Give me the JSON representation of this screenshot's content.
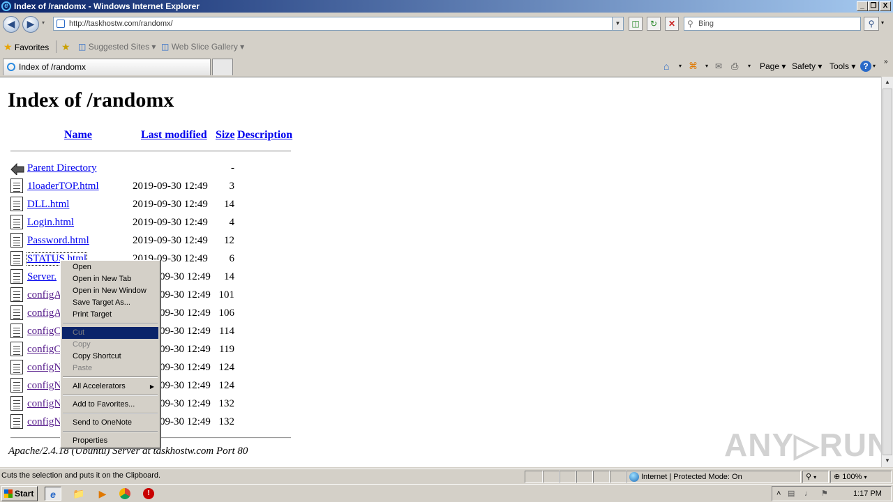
{
  "window": {
    "title": "Index of /randomx - Windows Internet Explorer",
    "controls": [
      "_",
      "❐",
      "X"
    ]
  },
  "nav": {
    "url": "http://taskhostw.com/randomx/",
    "search_placeholder": "Bing"
  },
  "favorites_bar": {
    "favorites": "Favorites",
    "suggested": "Suggested Sites ▾",
    "gallery": "Web Slice Gallery ▾"
  },
  "tab": {
    "title": "Index of /randomx"
  },
  "command_bar": {
    "page": "Page ▾",
    "safety": "Safety ▾",
    "tools": "Tools ▾"
  },
  "page": {
    "heading": "Index of /randomx",
    "columns": {
      "name": "Name",
      "modified": "Last modified",
      "size": "Size",
      "description": "Description"
    },
    "rows": [
      {
        "name": "Parent Directory",
        "date": "",
        "size": "-",
        "visited": false,
        "parent": true
      },
      {
        "name": "1loaderTOP.html",
        "date": "2019-09-30 12:49",
        "size": "3",
        "visited": false
      },
      {
        "name": "DLL.html",
        "date": "2019-09-30 12:49",
        "size": "14",
        "visited": false
      },
      {
        "name": "Login.html",
        "date": "2019-09-30 12:49",
        "size": "4",
        "visited": false
      },
      {
        "name": "Password.html",
        "date": "2019-09-30 12:49",
        "size": "12",
        "visited": false
      },
      {
        "name": "STATUS.html",
        "date": "2019-09-30 12:49",
        "size": "6",
        "visited": false
      },
      {
        "name": "Server.",
        "date": "09-30 12:49",
        "size": "14",
        "visited": false
      },
      {
        "name": "configA",
        "date": "09-30 12:49",
        "size": "101",
        "visited": true
      },
      {
        "name": "configA",
        "date": "09-30 12:49",
        "size": "106",
        "visited": true
      },
      {
        "name": "configC",
        "date": "09-30 12:49",
        "size": "114",
        "visited": true
      },
      {
        "name": "configC",
        "date": "09-30 12:49",
        "size": "119",
        "visited": true
      },
      {
        "name": "configN",
        "date": "09-30 12:49",
        "size": "124",
        "visited": true
      },
      {
        "name": "configN",
        "date": "09-30 12:49",
        "size": "124",
        "visited": true
      },
      {
        "name": "configN",
        "date": "09-30 12:49",
        "size": "132",
        "visited": true
      },
      {
        "name": "configN",
        "date": "09-30 12:49",
        "size": "132",
        "visited": true
      }
    ],
    "address": "Apache/2.4.18 (Ubuntu) Server at taskhostw.com Port 80",
    "watermark": "ANY▷RUN"
  },
  "context_menu": {
    "open": "Open",
    "open_tab": "Open in New Tab",
    "open_window": "Open in New Window",
    "save_target": "Save Target As...",
    "print_target": "Print Target",
    "cut": "Cut",
    "copy": "Copy",
    "copy_shortcut": "Copy Shortcut",
    "paste": "Paste",
    "accelerators": "All Accelerators",
    "add_favorites": "Add to Favorites...",
    "onenote": "Send to OneNote",
    "properties": "Properties"
  },
  "status": {
    "text": "Cuts the selection and puts it on the Clipboard.",
    "zone": "Internet | Protected Mode: On",
    "zoom": "100%"
  },
  "taskbar": {
    "start": "Start",
    "clock": "1:17 PM"
  },
  "colors": {
    "link": "#0000ee",
    "visited": "#551a8b",
    "selection": "#0a246a"
  }
}
